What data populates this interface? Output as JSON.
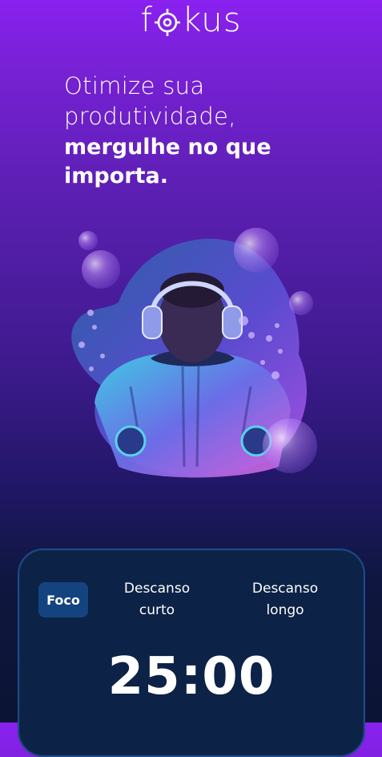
{
  "header": {
    "logo_prefix": "f",
    "logo_suffix": "kus"
  },
  "headline": {
    "line1": "Otimize sua",
    "line2": "produtividade,",
    "line3": "mergulhe no que",
    "line4": "importa."
  },
  "hero": {
    "image": "astronaut-with-headphones-and-bubbles"
  },
  "timer_card": {
    "tabs": [
      {
        "label": "Foco",
        "active": true
      },
      {
        "label": "Descanso\ncurto",
        "active": false
      },
      {
        "label": "Descanso\nlongo",
        "active": false
      }
    ],
    "time": "25:00"
  },
  "colors": {
    "gradient_top": "#8a21f0",
    "gradient_bottom": "#0b1433",
    "card_background": "#0c2246",
    "card_border": "#1c4a8a",
    "active_tab": "#144480"
  }
}
